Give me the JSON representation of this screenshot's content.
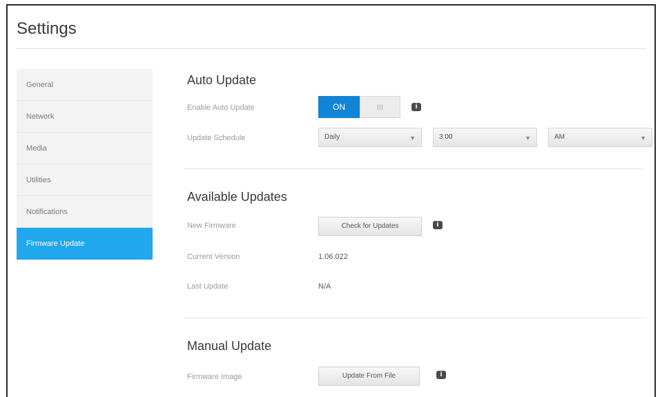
{
  "page": {
    "title": "Settings"
  },
  "sidebar": {
    "items": [
      {
        "label": "General"
      },
      {
        "label": "Network"
      },
      {
        "label": "Media"
      },
      {
        "label": "Utilities"
      },
      {
        "label": "Notifications"
      },
      {
        "label": "Firmware Update"
      }
    ],
    "active_index": 5
  },
  "auto_update": {
    "title": "Auto Update",
    "enable_label": "Enable Auto Update",
    "toggle_on": "ON",
    "toggle_off": "III",
    "toggle_state": "on",
    "schedule_label": "Update Schedule",
    "schedule_day": "Daily",
    "schedule_time": "3:00",
    "schedule_ampm": "AM"
  },
  "available_updates": {
    "title": "Available Updates",
    "new_firmware_label": "New Firmware",
    "check_button": "Check for Updates",
    "current_version_label": "Current Version",
    "current_version": "1.06.022",
    "last_update_label": "Last Update",
    "last_update": "N/A"
  },
  "manual_update": {
    "title": "Manual Update",
    "firmware_image_label": "Firmware Image",
    "update_button": "Update From File"
  },
  "icons": {
    "info": "info-icon",
    "dropdown": "chevron-down-icon"
  },
  "colors": {
    "accent": "#20a7ee",
    "toggle_on": "#1184d6"
  }
}
